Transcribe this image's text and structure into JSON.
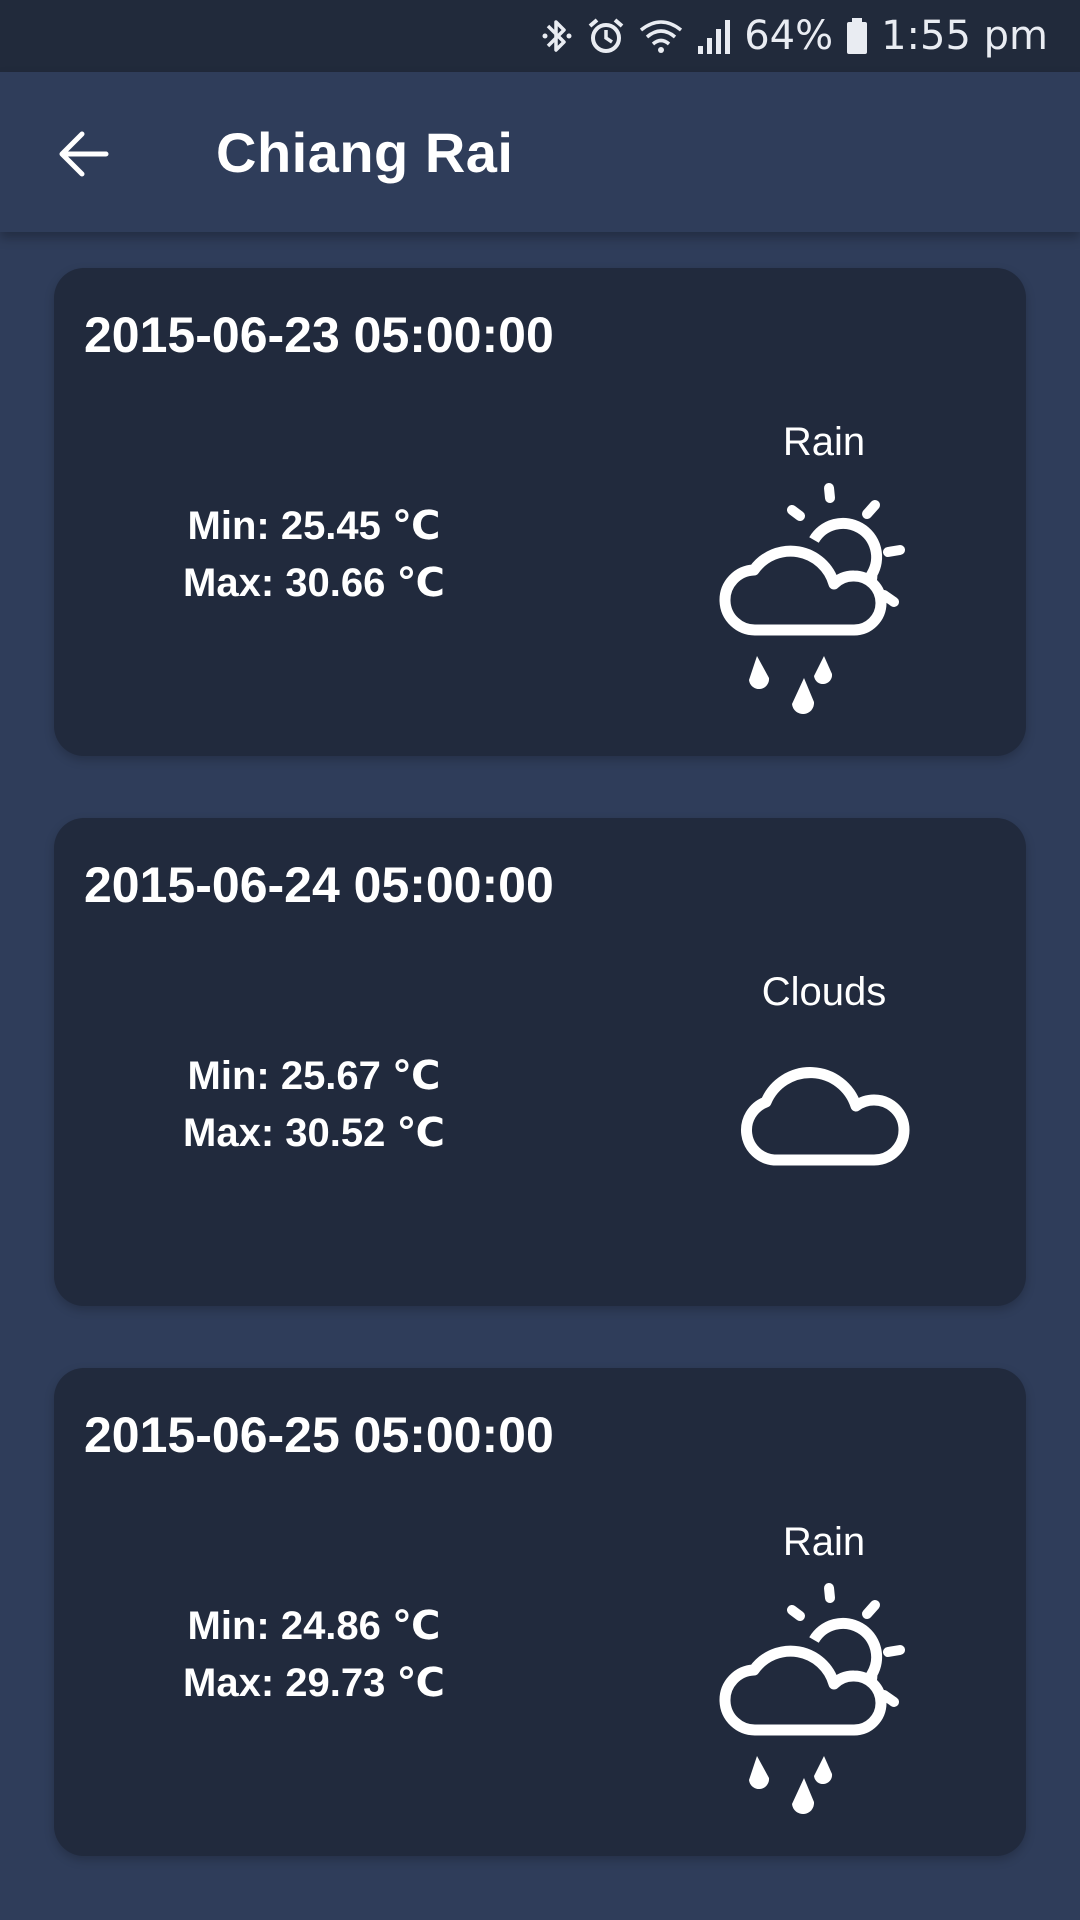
{
  "status_bar": {
    "icons": [
      "bluetooth-icon",
      "alarm-icon",
      "wifi-icon",
      "signal-icon",
      "battery-icon"
    ],
    "battery": "64%",
    "time": "1:55 pm"
  },
  "app_bar": {
    "back_icon": "arrow-left-icon",
    "title": "Chiang Rai"
  },
  "forecast": [
    {
      "datetime": "2015-06-23 05:00:00",
      "min": "Min: 25.45 ℃",
      "max": "Max: 30.66 ℃",
      "condition": "Rain",
      "icon": "rain-sun-icon"
    },
    {
      "datetime": "2015-06-24 05:00:00",
      "min": "Min: 25.67 ℃",
      "max": "Max: 30.52 ℃",
      "condition": "Clouds",
      "icon": "cloud-icon"
    },
    {
      "datetime": "2015-06-25 05:00:00",
      "min": "Min: 24.86 ℃",
      "max": "Max: 29.73 ℃",
      "condition": "Rain",
      "icon": "rain-sun-icon"
    }
  ],
  "colors": {
    "background": "#2f3d5a",
    "card": "#212a3d",
    "status_bar": "#212a3b",
    "text": "#ffffff"
  }
}
